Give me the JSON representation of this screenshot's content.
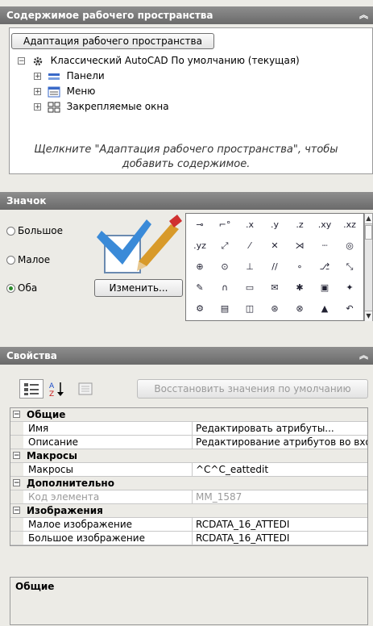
{
  "workspace": {
    "title": "Содержимое рабочего пространства",
    "customize_button": "Адаптация рабочего пространства",
    "tree_root": "Классический AutoCAD По умолчанию (текущая)",
    "tree_items": [
      "Панели",
      "Меню",
      "Закрепляемые окна"
    ],
    "hint_line1": "Щелкните \"Адаптация рабочего пространства\", чтобы",
    "hint_line2": "добавить содержимое."
  },
  "icon_panel": {
    "title": "Значок",
    "sizes": [
      {
        "label": "Большое",
        "checked": false
      },
      {
        "label": "Малое",
        "checked": false
      },
      {
        "label": "Оба",
        "checked": true
      }
    ],
    "edit_button": "Изменить...",
    "grid_row1": [
      "⊸",
      "⌐°",
      ".x",
      ".y",
      ".z",
      ".xy",
      ".xz"
    ],
    "grid_row2": [
      ".yz",
      "⤢",
      "⁄",
      "✕",
      "⋊",
      "┈",
      "◎"
    ],
    "grid_row3": [
      "⊕",
      "⊙",
      "⊥",
      "//",
      "∘",
      "⎇",
      "⤡"
    ],
    "grid_row4": [
      "✎",
      "∩",
      "▭",
      "✉",
      "✱",
      "▣",
      "✦"
    ],
    "grid_row5": [
      "⚙",
      "▤",
      "◫",
      "⊛",
      "⊗",
      "▲",
      "↶"
    ]
  },
  "properties": {
    "title": "Свойства",
    "reset_button": "Восстановить значения по умолчанию",
    "groups": [
      {
        "name": "Общие",
        "rows": [
          {
            "key": "Имя",
            "value": "Редактировать атрибуты..."
          },
          {
            "key": "Описание",
            "value": "Редактирование атрибутов во вхож"
          }
        ]
      },
      {
        "name": "Макросы",
        "rows": [
          {
            "key": "Макросы",
            "value": "^C^C_eattedit"
          }
        ]
      },
      {
        "name": "Дополнительно",
        "rows": [
          {
            "key": "Код элемента",
            "value": "MM_1587"
          }
        ]
      },
      {
        "name": "Изображения",
        "rows": [
          {
            "key": "Малое изображение",
            "value": "RCDATA_16_ATTEDI"
          },
          {
            "key": "Большое изображение",
            "value": "RCDATA_16_ATTEDI"
          }
        ]
      }
    ],
    "description_title": "Общие"
  },
  "colors": {
    "header_bg": "#7a7a7a",
    "accent_green": "#2a8a2a"
  }
}
